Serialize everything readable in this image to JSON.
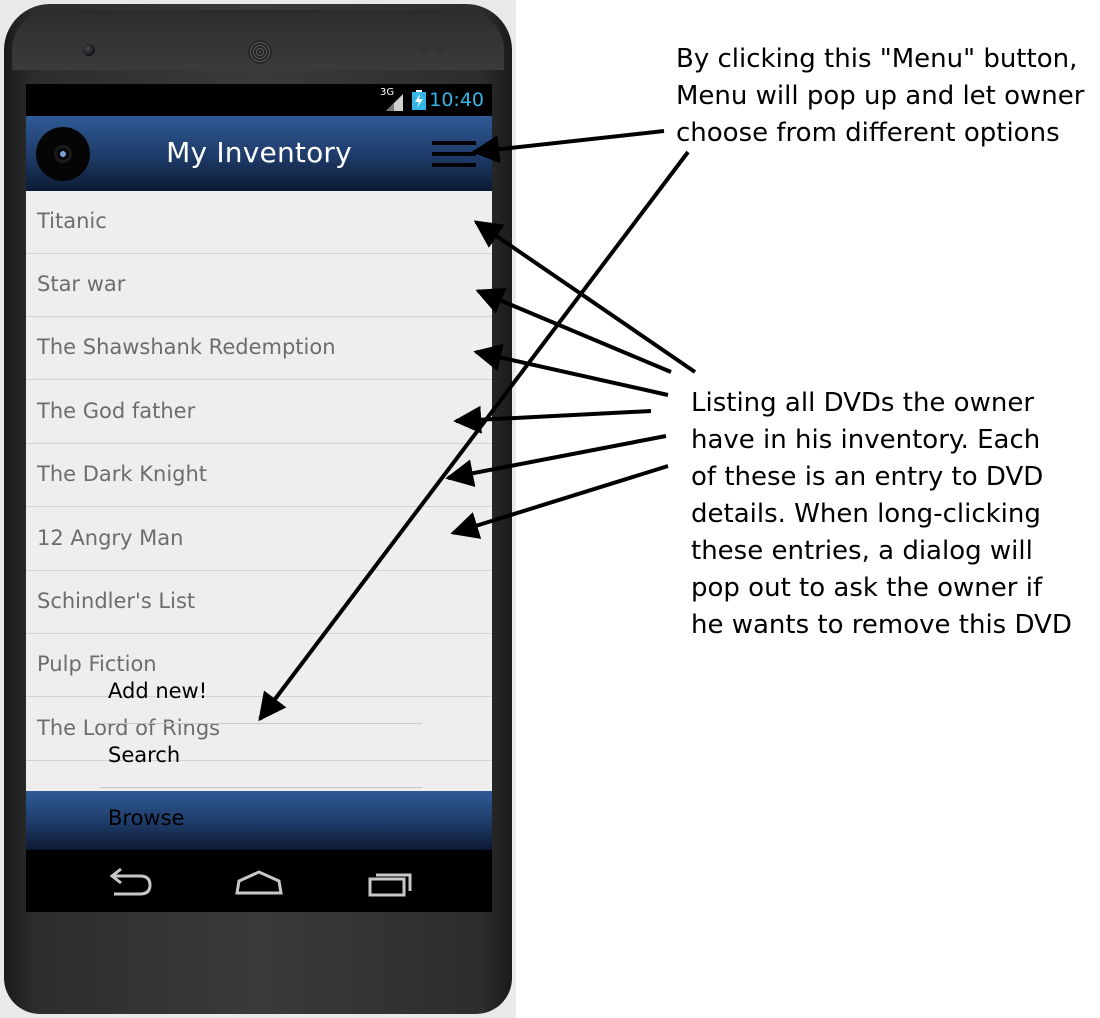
{
  "statusbar": {
    "network": "3G",
    "time": "10:40"
  },
  "actionbar": {
    "title": "My Inventory",
    "logo_icon": "dvd-disc-icon",
    "menu_icon": "hamburger-menu-icon"
  },
  "inventory": {
    "items": [
      {
        "label": "Titanic"
      },
      {
        "label": "Star war"
      },
      {
        "label": "The Shawshank Redemption"
      },
      {
        "label": "The God father"
      },
      {
        "label": "The Dark Knight"
      },
      {
        "label": "12 Angry Man"
      },
      {
        "label": "Schindler's List"
      },
      {
        "label": "Pulp Fiction"
      },
      {
        "label": "The Lord of Rings"
      }
    ]
  },
  "popup_menu": {
    "items": [
      {
        "label": "Add new!"
      },
      {
        "label": "Search"
      },
      {
        "label": "Browse"
      }
    ]
  },
  "navbar": {
    "back_icon": "back-icon",
    "home_icon": "home-icon",
    "recents_icon": "recents-icon"
  },
  "annotations": {
    "menu_note": [
      "By clicking this \"Menu\" button,",
      "Menu will pop up and let owner",
      "choose from different options"
    ],
    "list_note": [
      "Listing all DVDs the owner",
      "have in his inventory. Each",
      "of these is an entry to DVD",
      "details. When long-clicking",
      "these entries, a dialog will",
      "pop out to ask the owner if",
      "he wants to remove this DVD"
    ]
  },
  "colors": {
    "actionbar_top": "#2f5a95",
    "actionbar_bottom": "#0d1a33",
    "list_bg": "#eeeeee",
    "list_text": "#6d6d6d",
    "time_text": "#33b5e5"
  }
}
